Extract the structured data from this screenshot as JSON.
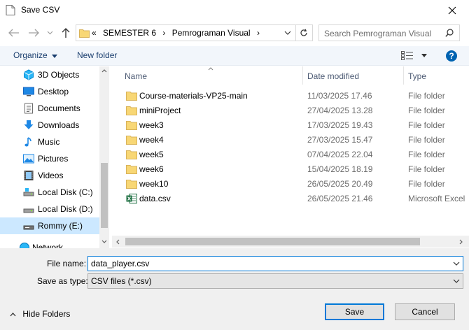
{
  "window": {
    "title": "Save CSV"
  },
  "address": {
    "prefix": "«",
    "segments": [
      "SEMESTER 6",
      "Pemrograman Visual"
    ]
  },
  "search": {
    "placeholder": "Search Pemrograman Visual"
  },
  "toolbar": {
    "organize_label": "Organize",
    "new_folder_label": "New folder"
  },
  "sidebar": {
    "items": [
      {
        "label": "3D Objects",
        "icon": "3d-objects-icon"
      },
      {
        "label": "Desktop",
        "icon": "desktop-icon"
      },
      {
        "label": "Documents",
        "icon": "documents-icon"
      },
      {
        "label": "Downloads",
        "icon": "downloads-icon"
      },
      {
        "label": "Music",
        "icon": "music-icon"
      },
      {
        "label": "Pictures",
        "icon": "pictures-icon"
      },
      {
        "label": "Videos",
        "icon": "videos-icon"
      },
      {
        "label": "Local Disk (C:)",
        "icon": "drive-icon"
      },
      {
        "label": "Local Disk (D:)",
        "icon": "drive-icon"
      },
      {
        "label": "Rommy (E:)",
        "icon": "usb-drive-icon",
        "selected": true
      },
      {
        "label": "Network",
        "icon": "network-icon"
      }
    ]
  },
  "columns": {
    "name": "Name",
    "date": "Date modified",
    "type": "Type"
  },
  "files": [
    {
      "name": "Course-materials-VP25-main",
      "date": "11/03/2025 17.46",
      "type": "File folder",
      "icon": "folder-icon"
    },
    {
      "name": "miniProject",
      "date": "27/04/2025 13.28",
      "type": "File folder",
      "icon": "folder-icon"
    },
    {
      "name": "week3",
      "date": "17/03/2025 19.43",
      "type": "File folder",
      "icon": "folder-icon"
    },
    {
      "name": "week4",
      "date": "27/03/2025 15.47",
      "type": "File folder",
      "icon": "folder-icon"
    },
    {
      "name": "week5",
      "date": "07/04/2025 22.04",
      "type": "File folder",
      "icon": "folder-icon"
    },
    {
      "name": "week6",
      "date": "15/04/2025 18.19",
      "type": "File folder",
      "icon": "folder-icon"
    },
    {
      "name": "week10",
      "date": "26/05/2025 20.49",
      "type": "File folder",
      "icon": "folder-icon"
    },
    {
      "name": "data.csv",
      "date": "26/05/2025 21.46",
      "type": "Microsoft Excel",
      "icon": "excel-file-icon"
    }
  ],
  "form": {
    "filename_label": "File name:",
    "filename_value": "data_player.csv",
    "savetype_label": "Save as type:",
    "savetype_value": "CSV files (*.csv)"
  },
  "footer": {
    "hide_folders_label": "Hide Folders",
    "save_label": "Save",
    "cancel_label": "Cancel"
  },
  "colors": {
    "accent": "#0078d7",
    "folder": "#f8d775",
    "selection": "#cce8ff",
    "help": "#0063b1"
  }
}
